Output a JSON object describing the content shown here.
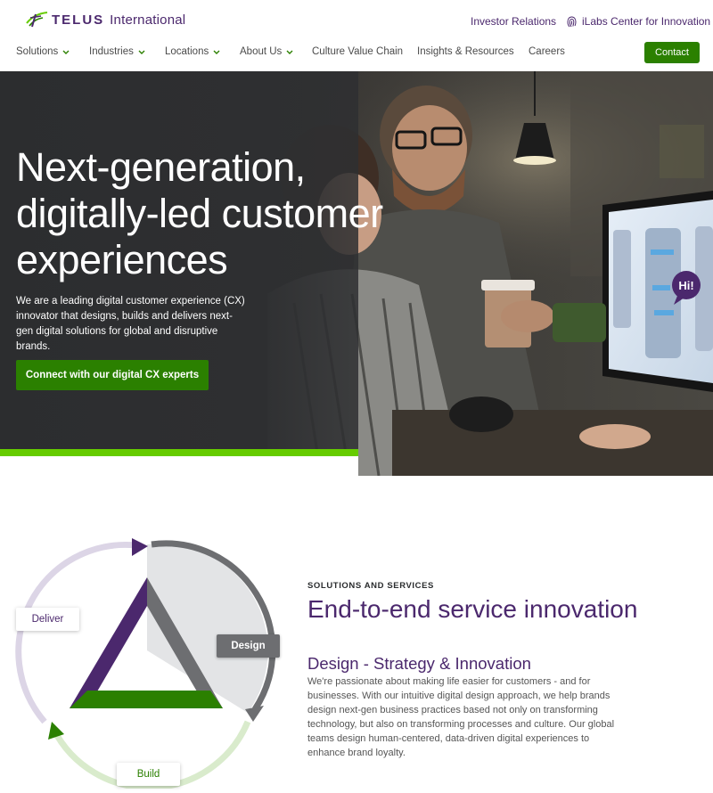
{
  "header": {
    "logo_brand": "TELUS",
    "logo_suffix": "International",
    "investor_relations": "Investor Relations",
    "ilabs": "iLabs Center for Innovation",
    "contact": "Contact"
  },
  "nav": {
    "items": [
      {
        "label": "Solutions",
        "has_dropdown": true
      },
      {
        "label": "Industries",
        "has_dropdown": true
      },
      {
        "label": "Locations",
        "has_dropdown": true
      },
      {
        "label": "About Us",
        "has_dropdown": true
      },
      {
        "label": "Culture Value Chain",
        "has_dropdown": false
      },
      {
        "label": "Insights & Resources",
        "has_dropdown": false
      },
      {
        "label": "Careers",
        "has_dropdown": false
      }
    ]
  },
  "hero": {
    "title_line1": "Next-generation,",
    "title_line2": "digitally-led customer",
    "title_line3": "experiences",
    "subtitle": "We are a leading digital customer experience (CX) innovator that designs, builds and delivers next-gen digital solutions for global and disruptive brands.",
    "cta": "Connect with our digital CX experts",
    "bubble": "Hi!"
  },
  "solutions": {
    "eyebrow": "SOLUTIONS AND SERVICES",
    "title": "End-to-end service innovation",
    "subtitle": "Design - Strategy & Innovation",
    "body": "We're passionate about making life easier for customers - and for businesses. With our intuitive digital design approach, we help brands design next-gen business practices based not only on transforming technology, but also on transforming processes and culture. Our global teams design human-centered, data-driven digital experiences to enhance brand loyalty.",
    "diagram_labels": {
      "deliver": "Deliver",
      "design": "Design",
      "build": "Build"
    },
    "active_stage": "Design"
  },
  "colors": {
    "brand_purple": "#4b286d",
    "brand_green": "#2b8000",
    "accent_green": "#66cc00",
    "design_gray": "#6d6e71"
  }
}
